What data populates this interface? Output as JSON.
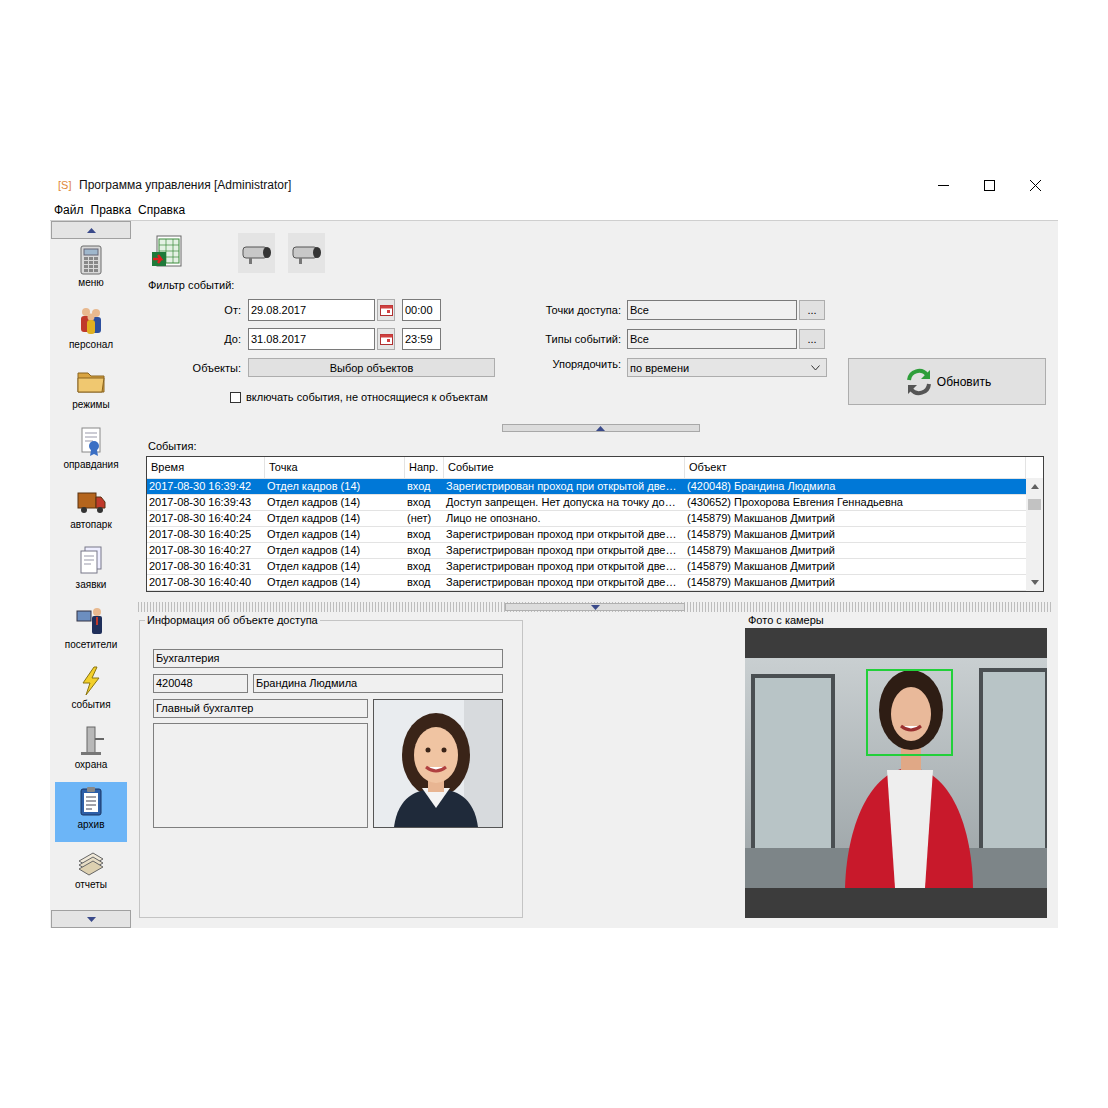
{
  "window": {
    "logo": "[S]",
    "title": "Программа управления [Administrator]"
  },
  "menu": [
    "Файл",
    "Правка",
    "Справка"
  ],
  "sidebar": {
    "items": [
      {
        "label": "меню",
        "selected": false
      },
      {
        "label": "персонал",
        "selected": false
      },
      {
        "label": "режимы",
        "selected": false
      },
      {
        "label": "оправдания",
        "selected": false
      },
      {
        "label": "автопарк",
        "selected": false
      },
      {
        "label": "заявки",
        "selected": false
      },
      {
        "label": "посетители",
        "selected": false
      },
      {
        "label": "события",
        "selected": false
      },
      {
        "label": "охрана",
        "selected": false
      },
      {
        "label": "архив",
        "selected": true
      },
      {
        "label": "отчеты",
        "selected": false
      }
    ]
  },
  "filter": {
    "title": "Фильтр событий:",
    "from": {
      "label": "От:",
      "date": "29.08.2017",
      "time": "00:00"
    },
    "to": {
      "label": "До:",
      "date": "31.08.2017",
      "time": "23:59"
    },
    "objects": {
      "label": "Объекты:",
      "button": "Выбор объектов"
    },
    "include_unrelated": {
      "label": "включать события, не относящиеся к объектам",
      "checked": false
    },
    "access_points": {
      "label": "Точки доступа:",
      "value": "Все",
      "button": "..."
    },
    "event_types": {
      "label": "Типы событий:",
      "value": "Все",
      "button": "..."
    },
    "sort": {
      "label": "Упорядочить:",
      "value": "по времени"
    },
    "refresh": "Обновить"
  },
  "events": {
    "label": "События:",
    "columns": [
      "Время",
      "Точка",
      "Напр.",
      "Событие",
      "Объект"
    ],
    "rows": [
      {
        "cells": [
          "2017-08-30 16:39:42",
          "Отдел кадров (14)",
          "вход",
          "Зарегистрирован проход при открытой две…",
          "(420048) Брандина Людмила"
        ],
        "selected": true
      },
      {
        "cells": [
          "2017-08-30 16:39:43",
          "Отдел кадров (14)",
          "вход",
          "Доступ запрещен. Нет допуска на точку до…",
          "(430652) Прохорова Евгения Геннадьевна"
        ],
        "selected": false
      },
      {
        "cells": [
          "2017-08-30 16:40:24",
          "Отдел кадров (14)",
          "(нет)",
          "Лицо не опознано.",
          "(145879) Макшанов Дмитрий"
        ],
        "selected": false
      },
      {
        "cells": [
          "2017-08-30 16:40:25",
          "Отдел кадров (14)",
          "вход",
          "Зарегистрирован проход при открытой две…",
          "(145879) Макшанов Дмитрий"
        ],
        "selected": false
      },
      {
        "cells": [
          "2017-08-30 16:40:27",
          "Отдел кадров (14)",
          "вход",
          "Зарегистрирован проход при открытой две…",
          "(145879) Макшанов Дмитрий"
        ],
        "selected": false
      },
      {
        "cells": [
          "2017-08-30 16:40:31",
          "Отдел кадров (14)",
          "вход",
          "Зарегистрирован проход при открытой две…",
          "(145879) Макшанов Дмитрий"
        ],
        "selected": false
      },
      {
        "cells": [
          "2017-08-30 16:40:40",
          "Отдел кадров (14)",
          "вход",
          "Зарегистрирован проход при открытой две…",
          "(145879) Макшанов Дмитрий"
        ],
        "selected": false
      }
    ]
  },
  "info": {
    "legend": "Информация об объекте доступа",
    "department": "Бухгалтерия",
    "id": "420048",
    "name": "Брандина Людмила",
    "position": "Главный бухгалтер"
  },
  "camera": {
    "label": "Фото с камеры"
  }
}
